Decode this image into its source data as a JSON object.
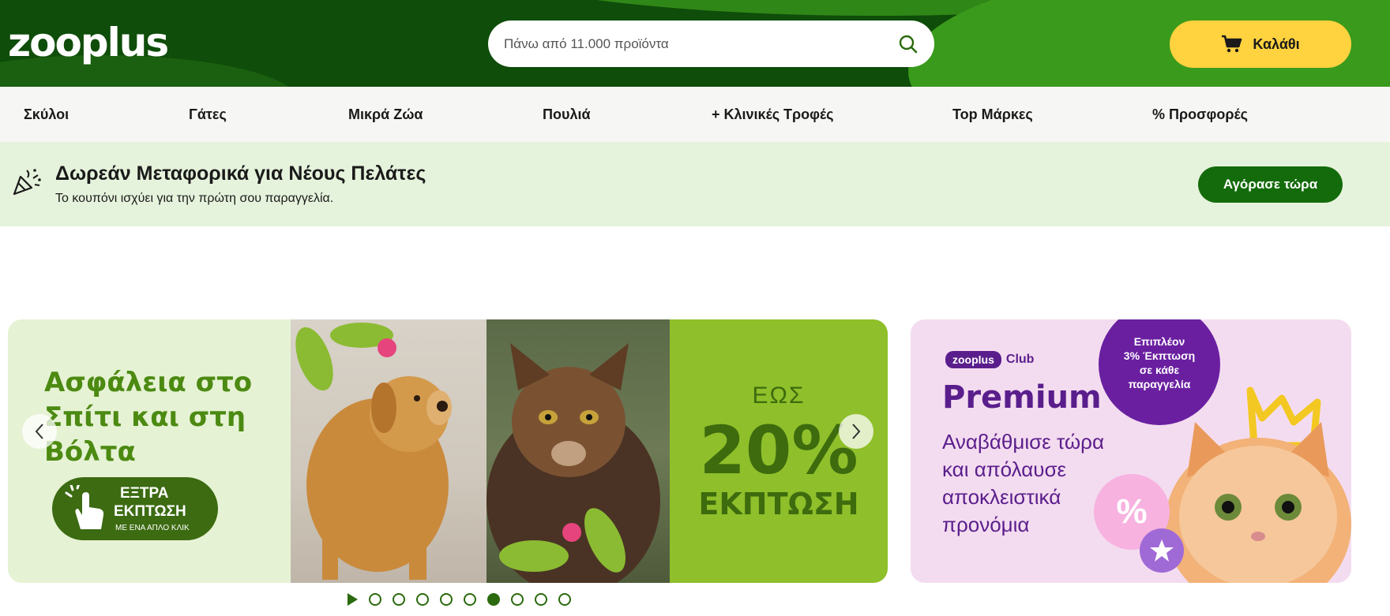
{
  "header": {
    "logo": "zooplus",
    "search_placeholder": "Πάνω από 11.000 προϊόντα",
    "cart_label": "Καλάθι"
  },
  "nav": {
    "items": [
      {
        "label": "Σκύλοι"
      },
      {
        "label": "Γάτες"
      },
      {
        "label": "Μικρά Ζώα"
      },
      {
        "label": "Πουλιά"
      },
      {
        "label": "+ Κλινικές Τροφές"
      },
      {
        "label": "Top Μάρκες"
      },
      {
        "label": "% Προσφορές"
      }
    ]
  },
  "promo": {
    "title": "Δωρεάν Μεταφορικά για Νέους Πελάτες",
    "subtitle": "Το κουπόνι ισχύει για την πρώτη σου παραγγελία.",
    "button": "Αγόρασε τώρα"
  },
  "hero": {
    "title": "Ασφάλεια στο Σπίτι και στη Βόλτα",
    "badge_line1": "ΕΞΤΡΑ",
    "badge_line2": "ΕΚΠΤΩΣΗ",
    "badge_line3": "ΜΕ ΕΝΑ ΑΠΛΟ ΚΛΙΚ",
    "discount_prefix": "ΕΩΣ",
    "discount_value": "20%",
    "discount_word": "ΕΚΠΤΩΣΗ",
    "slide_count": 9,
    "active_slide": 6
  },
  "club": {
    "logo_pill": "zooplus",
    "logo_word": "Club",
    "title": "Premium",
    "desc": "Αναβάθμισε τώρα και απόλαυσε αποκλειστικά προνόμια",
    "badge_l1": "Επιπλέον",
    "badge_l2": "3% Έκπτωση",
    "badge_l3": "σε κάθε",
    "badge_l4": "παραγγελία",
    "pct_symbol": "%"
  },
  "colors": {
    "header_green": "#0f4d0a",
    "cart_yellow": "#ffd23f",
    "promo_bg": "#e6f3dc",
    "button_green": "#146b0b",
    "club_purple": "#5a1e8c"
  }
}
